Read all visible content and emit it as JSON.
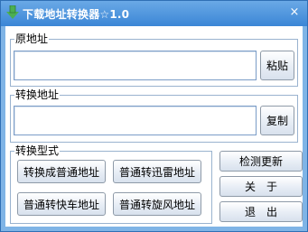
{
  "window": {
    "title": "下载地址转换器☆1.0",
    "close_label": "×"
  },
  "source": {
    "group_label": "原地址",
    "value": "",
    "paste_label": "粘贴"
  },
  "converted": {
    "group_label": "转换地址",
    "value": "",
    "copy_label": "复制"
  },
  "convert_type": {
    "group_label": "转换型式",
    "buttons": [
      "转换成普通地址",
      "普通转迅雷地址",
      "普通转快车地址",
      "普通转旋风地址"
    ]
  },
  "actions": {
    "check_update": "检测更新",
    "about": "关　于",
    "exit": "退　出"
  },
  "colors": {
    "title_bar": "#3b86d6",
    "frame": "#7fb4e6",
    "icon": "#4caf50"
  }
}
